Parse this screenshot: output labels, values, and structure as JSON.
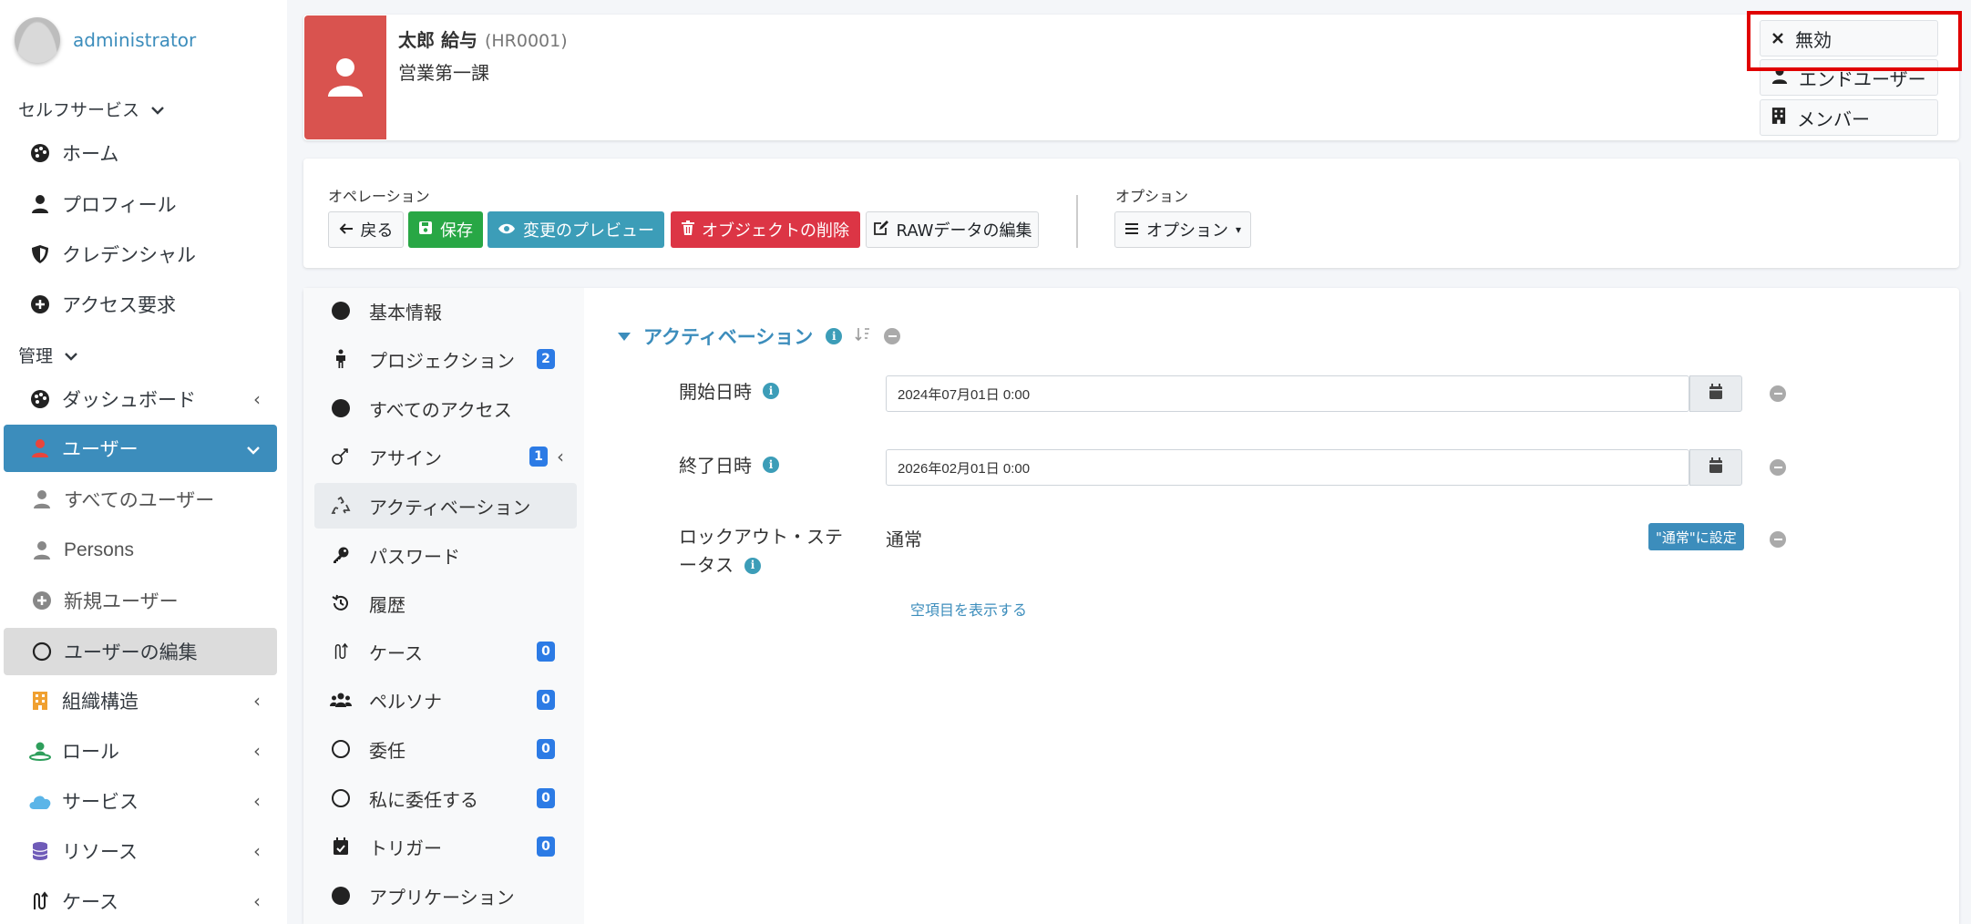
{
  "sidebar": {
    "user": {
      "name": "administrator"
    },
    "self_service": {
      "header": "セルフサービス",
      "items": [
        {
          "label": "ホーム",
          "icon": "palette-icon"
        },
        {
          "label": "プロフィール",
          "icon": "user-icon"
        },
        {
          "label": "クレデンシャル",
          "icon": "shield-icon"
        },
        {
          "label": "アクセス要求",
          "icon": "plus-circle-icon"
        }
      ]
    },
    "admin": {
      "header": "管理",
      "items": [
        {
          "label": "ダッシュボード",
          "icon": "palette-icon"
        },
        {
          "label": "ユーザー",
          "icon": "user-icon"
        },
        {
          "label": "すべてのユーザー",
          "icon": "user-icon"
        },
        {
          "label": "Persons",
          "icon": "user-icon"
        },
        {
          "label": "新規ユーザー",
          "icon": "plus-circle-icon"
        },
        {
          "label": "ユーザーの編集",
          "icon": "circle-icon"
        },
        {
          "label": "組織構造",
          "icon": "building-icon"
        },
        {
          "label": "ロール",
          "icon": "role-icon"
        },
        {
          "label": "サービス",
          "icon": "cloud-icon"
        },
        {
          "label": "リソース",
          "icon": "database-icon"
        },
        {
          "label": "ケース",
          "icon": "case-icon"
        }
      ]
    }
  },
  "header": {
    "name": "太郎 給与",
    "id": "(HR0001)",
    "department": "営業第一課",
    "buttons": {
      "disable": "無効",
      "end_user": "エンドユーザー",
      "member": "メンバー"
    }
  },
  "operations": {
    "label": "オペレーション",
    "back": "戻る",
    "save": "保存",
    "preview": "変更のプレビュー",
    "delete": "オブジェクトの削除",
    "raw_edit": "RAWデータの編集",
    "options_label": "オプション",
    "options_button": "オプション"
  },
  "tabs": [
    {
      "label": "基本情報",
      "icon": "dot-icon",
      "badge": ""
    },
    {
      "label": "プロジェクション",
      "icon": "person-icon",
      "badge": "2"
    },
    {
      "label": "すべてのアクセス",
      "icon": "dot-icon",
      "badge": ""
    },
    {
      "label": "アサイン",
      "icon": "assign-icon",
      "badge": "1"
    },
    {
      "label": "アクティベーション",
      "icon": "recycle-icon",
      "badge": ""
    },
    {
      "label": "パスワード",
      "icon": "key-icon",
      "badge": ""
    },
    {
      "label": "履歴",
      "icon": "history-icon",
      "badge": ""
    },
    {
      "label": "ケース",
      "icon": "case-icon",
      "badge": "0"
    },
    {
      "label": "ペルソナ",
      "icon": "users-icon",
      "badge": "0"
    },
    {
      "label": "委任",
      "icon": "circle-icon",
      "badge": "0"
    },
    {
      "label": "私に委任する",
      "icon": "circle-icon",
      "badge": "0"
    },
    {
      "label": "トリガー",
      "icon": "calendar-check-icon",
      "badge": "0"
    },
    {
      "label": "アプリケーション",
      "icon": "dot-icon",
      "badge": ""
    }
  ],
  "activation": {
    "title": "アクティベーション",
    "start_label": "開始日時",
    "start_value": "2024年07月01日 0:00",
    "end_label": "終了日時",
    "end_value": "2026年02月01日 0:00",
    "lockout_label_1": "ロックアウト・ステ",
    "lockout_label_2": "ータス",
    "lockout_value": "通常",
    "lockout_button": "\"通常\"に設定",
    "show_empty": "空項目を表示する"
  },
  "colors": {
    "accent": "#3c8dbc",
    "header_avatar": "#d9534f",
    "success": "#28a745",
    "info": "#3c9db8",
    "danger": "#dc3545",
    "badge": "#2c7be5",
    "highlight": "#e00000"
  }
}
